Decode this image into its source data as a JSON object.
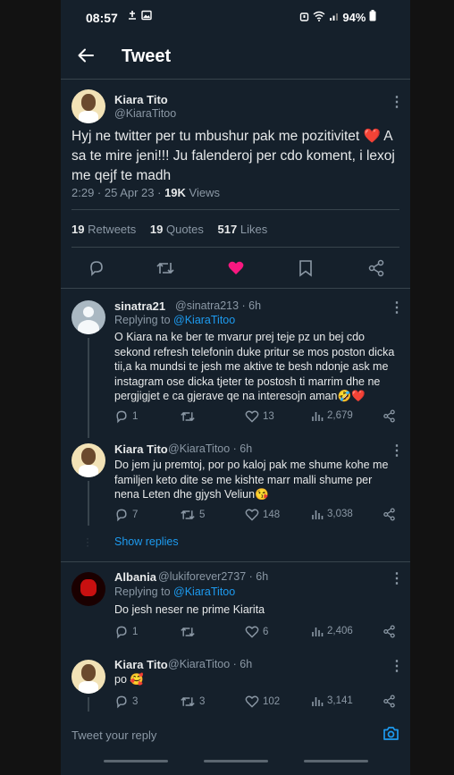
{
  "status_bar": {
    "time": "08:57",
    "battery": "94%"
  },
  "header": {
    "title": "Tweet"
  },
  "main_tweet": {
    "name": "Kiara Tito",
    "handle": "@KiaraTitoo",
    "text": "Hyj ne twitter per tu mbushur pak me pozitivitet ❤️ A sa te mire jeni!!! Ju falenderoj per cdo koment, i lexoj me qejf te madh",
    "time": "2:29 · 25 Apr 23 · ",
    "views_count": "19K",
    "views_label": " Views",
    "retweets": "19",
    "retweets_label": " Retweets",
    "quotes": "19",
    "quotes_label": " Quotes",
    "likes": "517",
    "likes_label": " Likes"
  },
  "replies": [
    {
      "name": "sinatra21",
      "handle": "@sinatra213 · 6h",
      "replying_prefix": "Replying to ",
      "replying_to": "@KiaraTitoo",
      "text": "O Kiara na ke ber te mvarur prej teje pz un bej cdo sekond refresh telefonin duke pritur se mos poston dicka tii,a ka mundsi te jesh me aktive te besh ndonje ask me instagram ose dicka tjeter te postosh ti marrim dhe ne pergjigjet e ca gjerave qe na interesojn aman🤣❤️",
      "reply_count": "1",
      "retweet_count": "",
      "like_count": "13",
      "views": "2,679"
    },
    {
      "name": "Kiara Tito",
      "handle": "@KiaraTitoo · 6h",
      "text": "Do jem ju premtoj, por po kaloj pak me shume kohe me familjen keto dite se me kishte marr malli shume per nena Leten dhe gjysh Veliun😘",
      "reply_count": "7",
      "retweet_count": "5",
      "like_count": "148",
      "views": "3,038",
      "show_replies": "Show replies"
    },
    {
      "name": "Albania",
      "handle": "@lukiforever2737 · 6h",
      "replying_prefix": "Replying to ",
      "replying_to": "@KiaraTitoo",
      "text": "Do jesh neser ne prime Kiarita",
      "reply_count": "1",
      "retweet_count": "",
      "like_count": "6",
      "views": "2,406"
    },
    {
      "name": "Kiara Tito",
      "handle": "@KiaraTitoo · 6h",
      "text": "po 🥰",
      "reply_count": "3",
      "retweet_count": "3",
      "like_count": "102",
      "views": "3,141"
    }
  ],
  "composer": {
    "placeholder": "Tweet your reply"
  },
  "icons": [
    "back-arrow-icon",
    "more-icon",
    "reply-icon",
    "retweet-icon",
    "like-icon",
    "bookmark-icon",
    "share-icon",
    "views-icon",
    "camera-icon"
  ],
  "colors": {
    "background": "#15202b",
    "accent": "#1d9bf0",
    "like": "#f91880",
    "muted": "#8b98a5",
    "divider": "#38444d"
  }
}
